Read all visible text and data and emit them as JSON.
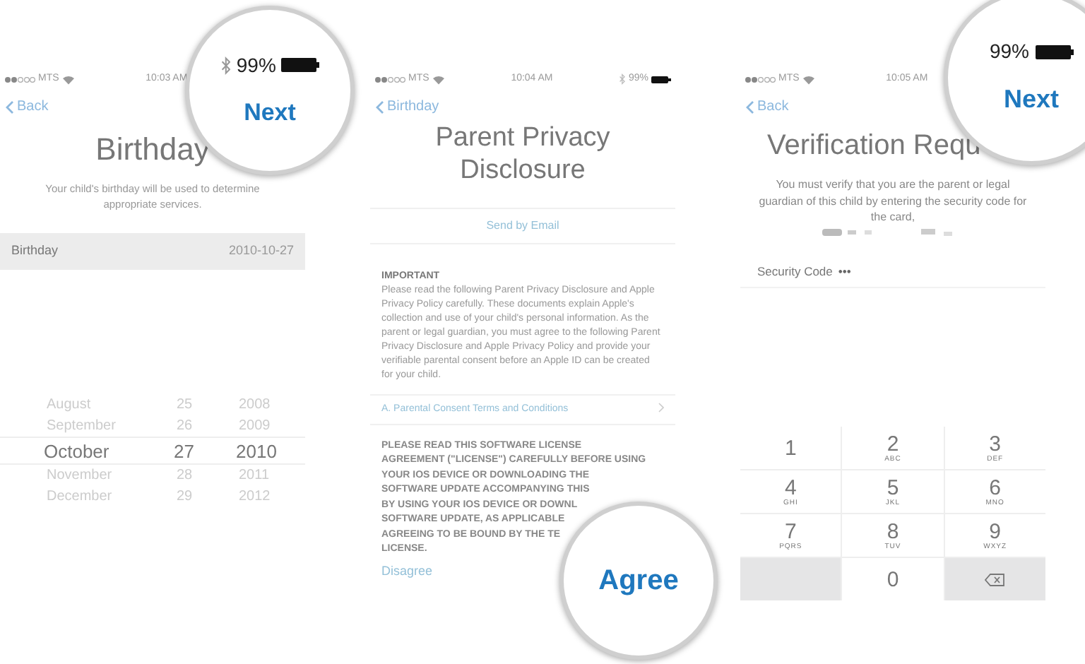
{
  "screens": [
    {
      "kind": "birthday",
      "status": {
        "carrier": "MTS",
        "time": "10:03 AM"
      },
      "back": "Back",
      "title": "Birthday",
      "description": "Your child's birthday will be used to determine appropriate services.",
      "field": {
        "label": "Birthday",
        "value": "2010-10-27"
      },
      "picker": [
        {
          "month": "August",
          "day": "25",
          "year": "2008",
          "selected": false
        },
        {
          "month": "September",
          "day": "26",
          "year": "2009",
          "selected": false
        },
        {
          "month": "October",
          "day": "27",
          "year": "2010",
          "selected": true
        },
        {
          "month": "November",
          "day": "28",
          "year": "2011",
          "selected": false
        },
        {
          "month": "December",
          "day": "29",
          "year": "2012",
          "selected": false
        }
      ],
      "magnifier": {
        "battery": "99%",
        "action": "Next",
        "bluetooth": true
      }
    },
    {
      "kind": "disclosure",
      "status": {
        "carrier": "MTS",
        "time": "10:04 AM",
        "battery": "99%"
      },
      "back": "Birthday",
      "title": "Parent Privacy Disclosure",
      "email_link": "Send by Email",
      "heading": "IMPORTANT",
      "body": "Please read the following Parent Privacy Disclosure and Apple Privacy Policy carefully. These documents explain Apple's collection and use of your child's personal information. As the parent or legal guardian, you must agree to the following Parent Privacy Disclosure and Apple Privacy Policy and provide your verifiable parental consent before an Apple ID can be created for your child.",
      "terms_link": "A. Parental Consent Terms and Conditions",
      "license_lines": [
        "PLEASE READ THIS SOFTWARE LICENSE",
        "AGREEMENT (\"LICENSE\") CAREFULLY BEFORE USING",
        "YOUR IOS DEVICE OR DOWNLOADING THE",
        "SOFTWARE UPDATE ACCOMPANYING THIS",
        "BY USING YOUR IOS DEVICE OR DOWNL",
        "SOFTWARE UPDATE, AS APPLICABLE",
        "AGREEING TO BE BOUND BY THE TE",
        "LICENSE."
      ],
      "disagree": "Disagree",
      "magnifier": {
        "action": "Agree"
      }
    },
    {
      "kind": "verification",
      "status": {
        "carrier": "MTS",
        "time": "10:05 AM"
      },
      "back": "Back",
      "title": "Verification Requ",
      "description": "You must verify that you are the parent or legal guardian of this child by entering the security code for the card,",
      "code_field": {
        "label": "Security Code",
        "value": "•••"
      },
      "keys": [
        {
          "kind": "digit",
          "digit": "1"
        },
        {
          "kind": "digit",
          "digit": "2",
          "letters": "ABC"
        },
        {
          "kind": "digit",
          "digit": "3",
          "letters": "DEF"
        },
        {
          "kind": "digit",
          "digit": "4",
          "letters": "GHI"
        },
        {
          "kind": "digit",
          "digit": "5",
          "letters": "JKL"
        },
        {
          "kind": "digit",
          "digit": "6",
          "letters": "MNO"
        },
        {
          "kind": "digit",
          "digit": "7",
          "letters": "PQRS"
        },
        {
          "kind": "digit",
          "digit": "8",
          "letters": "TUV"
        },
        {
          "kind": "digit",
          "digit": "9",
          "letters": "WXYZ"
        },
        {
          "kind": "blank"
        },
        {
          "kind": "digit",
          "digit": "0"
        },
        {
          "kind": "delete"
        }
      ],
      "magnifier": {
        "battery": "99%",
        "action": "Next",
        "bluetooth": false
      }
    }
  ]
}
